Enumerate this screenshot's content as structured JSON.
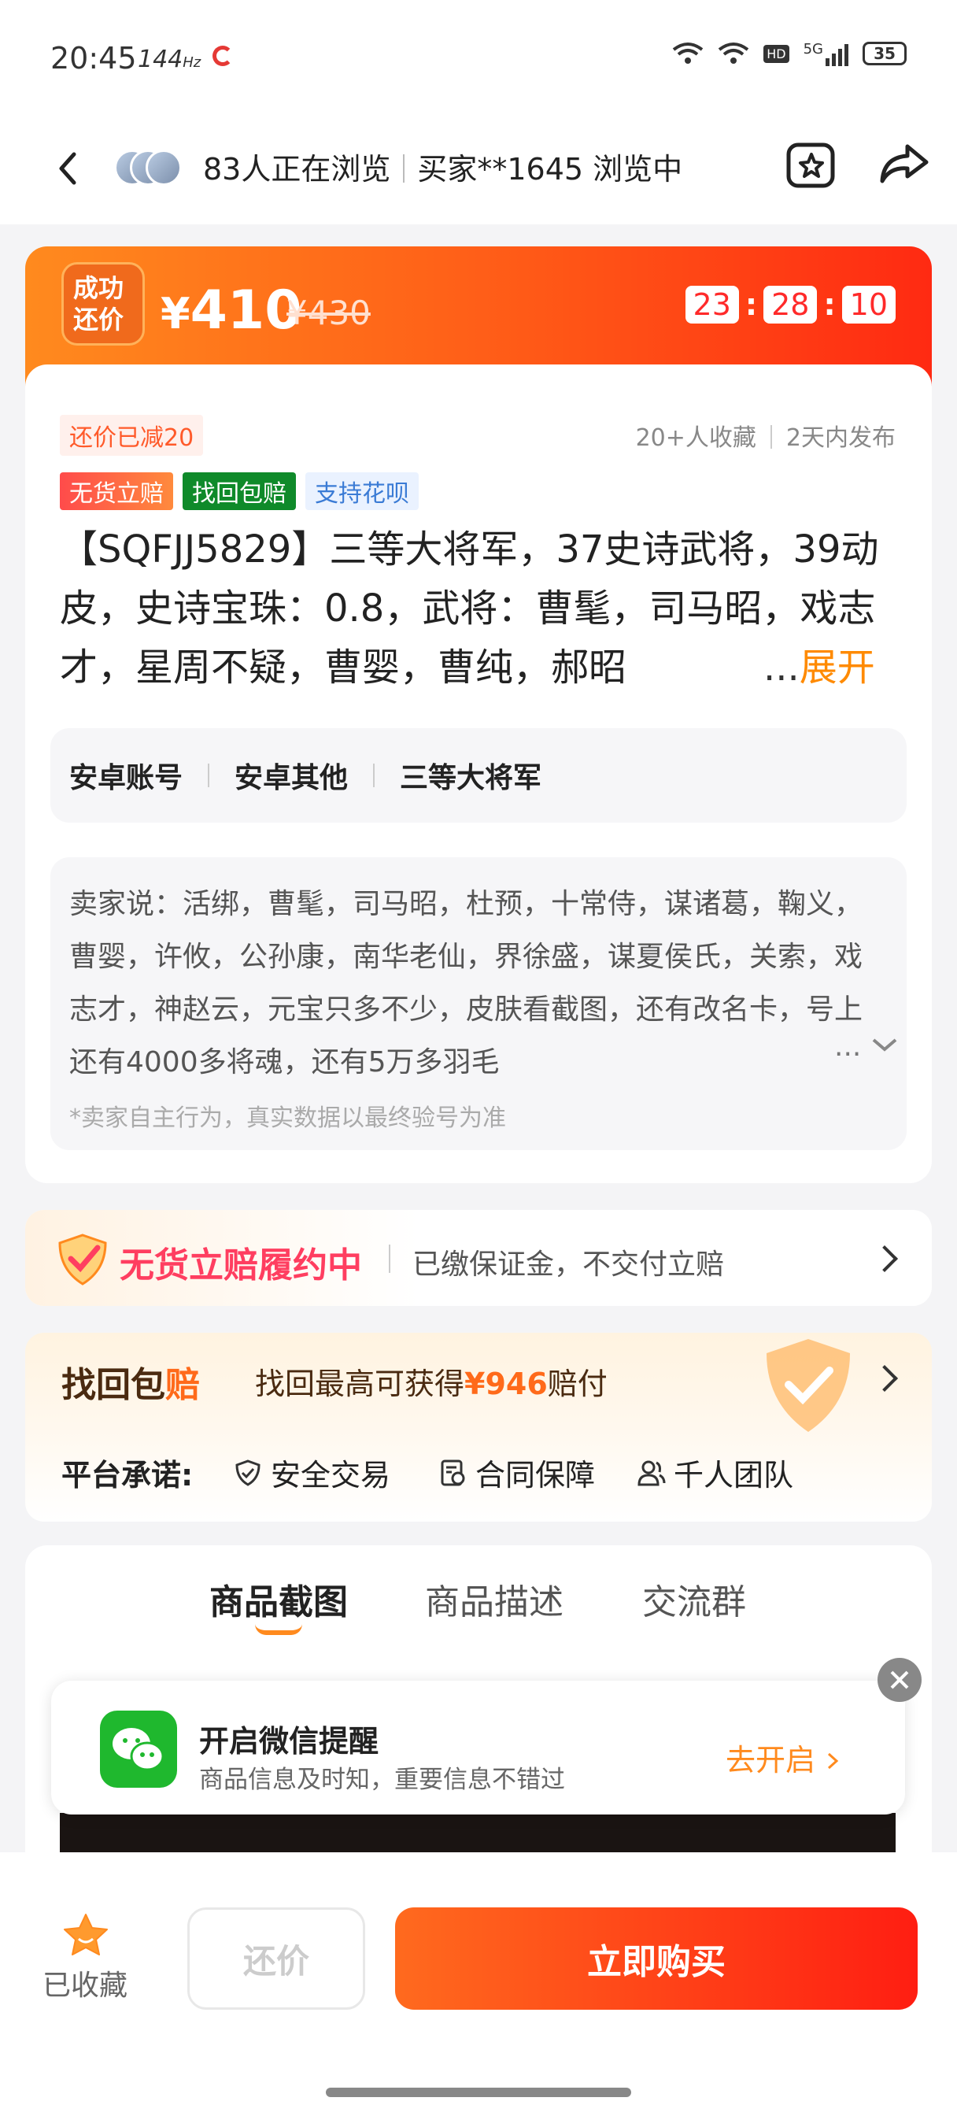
{
  "status_bar": {
    "time": "20:45",
    "refresh": "144",
    "refresh_unit": "Hz",
    "network": "5G",
    "hd": "HD",
    "battery": "35"
  },
  "nav": {
    "viewers": "83人正在浏览",
    "buyer": "买家**1645 浏览中"
  },
  "price": {
    "badge": "成功\n还价",
    "currency": "¥",
    "current": "410",
    "original": "¥430",
    "countdown": [
      "23",
      "28",
      "10"
    ]
  },
  "item": {
    "discount_tag": "还价已减20",
    "favorites": "20+人收藏",
    "published": "2天内发布",
    "tags": [
      "无货立赔",
      "找回包赔",
      "支持花呗"
    ],
    "title": "【SQFJJ5829】三等大将军，37史诗武将，39动皮，史诗宝珠：0.8，武将：曹髦，司马昭，戏志才，星周不疑，曹婴，曹纯，郝昭",
    "expand_prefix": "...",
    "expand_label": "展开",
    "categories": [
      "安卓账号",
      "安卓其他",
      "三等大将军"
    ],
    "seller_say": "卖家说：活绑，曹髦，司马昭，杜预，十常侍，谋诸葛，鞠义，曹婴，许攸，公孙康，南华老仙，界徐盛，谋夏侯氏，关索，戏志才，神赵云，元宝只多不少，皮肤看截图，还有改名卡，号上还有4000多将魂，还有5万多羽毛",
    "seller_ellipsis": "...",
    "seller_note": "*卖家自主行为，真实数据以最终验号为准"
  },
  "guarantee": {
    "title": "无货立赔履约中",
    "desc": "已缴保证金，不交付立赔"
  },
  "recovery": {
    "logo_a": "找回包",
    "logo_b": "赔",
    "text_prefix": "找回最高可获得",
    "amount": "¥946",
    "text_suffix": "赔付",
    "promise_label": "平台承诺:",
    "promises": [
      "安全交易",
      "合同保障",
      "千人团队"
    ]
  },
  "tabs": [
    "商品截图",
    "商品描述",
    "交流群"
  ],
  "wechat": {
    "title": "开启微信提醒",
    "subtitle": "商品信息及时知，重要信息不错过",
    "action": "去开启"
  },
  "bottom": {
    "favorite": "已收藏",
    "offer": "还价",
    "buy": "立即购买"
  },
  "colors": {
    "accent": "#ff5a17",
    "orange": "#ff8a1e",
    "red": "#ff2a12",
    "wechat_green": "#1fb82e"
  }
}
